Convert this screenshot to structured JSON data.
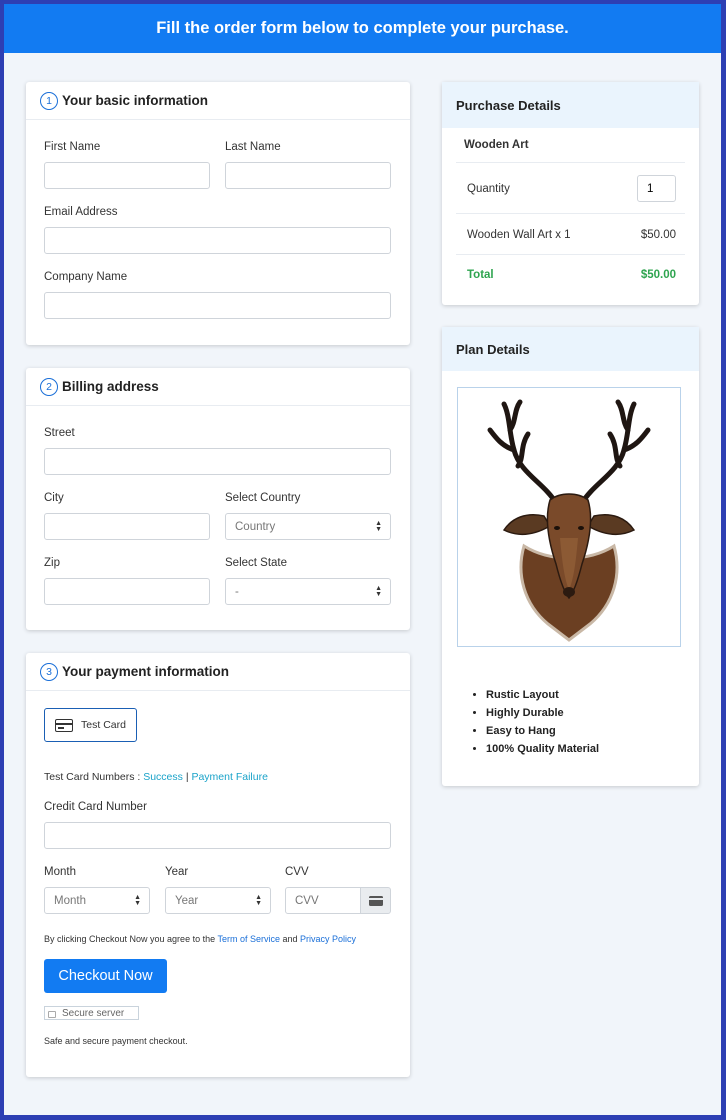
{
  "header": {
    "title": "Fill the order form below to complete your purchase."
  },
  "basic": {
    "step": "1",
    "title": "Your basic information",
    "first_name_label": "First Name",
    "last_name_label": "Last Name",
    "email_label": "Email Address",
    "company_label": "Company Name"
  },
  "billing": {
    "step": "2",
    "title": "Billing address",
    "street_label": "Street",
    "city_label": "City",
    "country_label": "Select Country",
    "country_value": "Country",
    "zip_label": "Zip",
    "state_label": "Select State",
    "state_value": "-"
  },
  "payment": {
    "step": "3",
    "title": "Your payment information",
    "test_card_label": "Test Card",
    "test_numbers_label": "Test Card Numbers :",
    "success_link": "Success",
    "separator": "|",
    "failure_link": "Payment Failure",
    "card_number_label": "Credit Card Number",
    "month_label": "Month",
    "month_value": "Month",
    "year_label": "Year",
    "year_value": "Year",
    "cvv_label": "CVV",
    "cvv_placeholder": "CVV",
    "agree_prefix": "By clicking Checkout Now you agree to the",
    "terms_link": "Term of Service",
    "and": "and",
    "privacy_link": "Privacy Policy",
    "checkout_label": "Checkout Now",
    "secure_label": "Secure server",
    "safe_text": "Safe and secure payment checkout."
  },
  "purchase": {
    "title": "Purchase Details",
    "product": "Wooden Art",
    "quantity_label": "Quantity",
    "quantity_value": "1",
    "line_item": "Wooden Wall Art x 1",
    "line_price": "$50.00",
    "total_label": "Total",
    "total_value": "$50.00"
  },
  "plan": {
    "title": "Plan Details",
    "features": [
      "Rustic Layout",
      "Highly Durable",
      "Easy to Hang",
      "100% Quality Material"
    ]
  },
  "colors": {
    "primary": "#127bf2",
    "total_green": "#2ea44f",
    "link_teal": "#1aa3c9"
  }
}
